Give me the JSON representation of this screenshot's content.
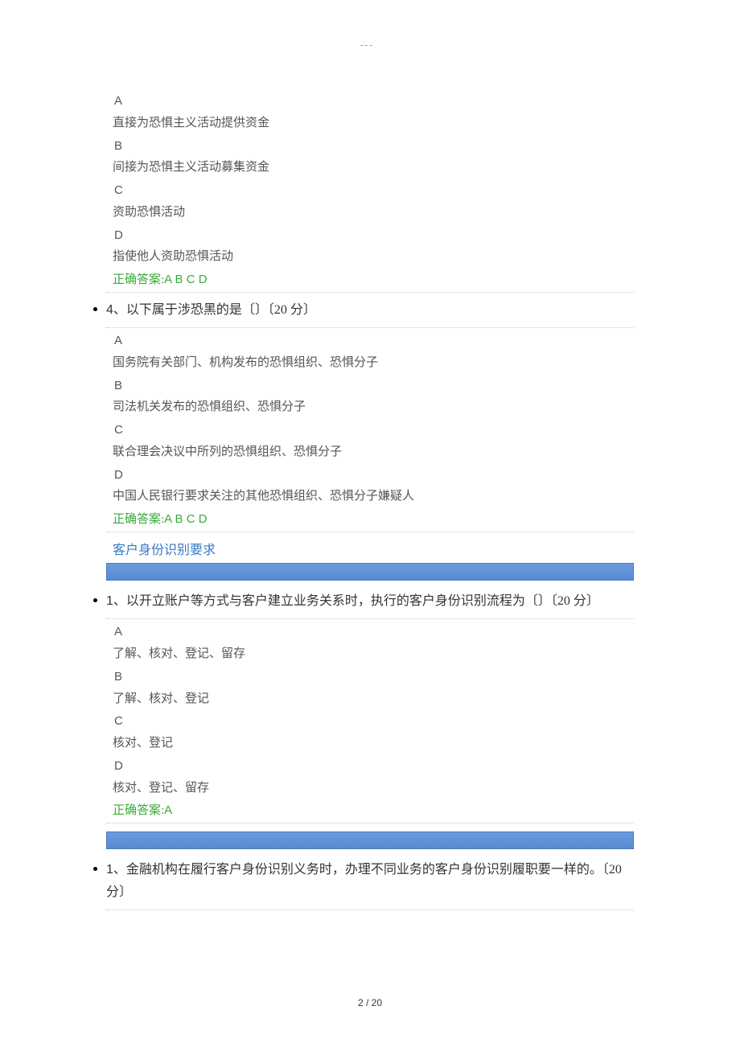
{
  "header_link": "---",
  "q3": {
    "options": [
      {
        "letter": "A",
        "text": "直接为恐惧主义活动提供资金"
      },
      {
        "letter": "B",
        "text": "间接为恐惧主义活动募集资金"
      },
      {
        "letter": "C",
        "text": "资助恐惧活动"
      },
      {
        "letter": "D",
        "text": "指使他人资助恐惧活动"
      }
    ],
    "answer_label": "正确答案:",
    "answer_value": "A B C D"
  },
  "q4": {
    "number": "4、",
    "stem": "以下属于涉恐黑的是〔〕〔20 分〕",
    "options": [
      {
        "letter": "A",
        "text": "国务院有关部门、机构发布的恐惧组织、恐惧分子"
      },
      {
        "letter": "B",
        "text": "司法机关发布的恐惧组织、恐惧分子"
      },
      {
        "letter": "C",
        "text": "联合理会决议中所列的恐惧组织、恐惧分子"
      },
      {
        "letter": "D",
        "text": "中国人民银行要求关注的其他恐惧组织、恐惧分子嫌疑人"
      }
    ],
    "answer_label": "正确答案:",
    "answer_value": "A B C D"
  },
  "section2": {
    "title": "客户身份识别要求"
  },
  "s2q1": {
    "number": "1、",
    "stem": "以开立账户等方式与客户建立业务关系时，执行的客户身份识别流程为〔〕〔20 分〕",
    "options": [
      {
        "letter": "A",
        "text": "了解、核对、登记、留存"
      },
      {
        "letter": "B",
        "text": "了解、核对、登记"
      },
      {
        "letter": "C",
        "text": "核对、登记"
      },
      {
        "letter": "D",
        "text": "核对、登记、留存"
      }
    ],
    "answer_label": "正确答案:",
    "answer_value": "A"
  },
  "s2q2": {
    "number": "1、",
    "stem": "金融机构在履行客户身份识别义务时，办理不同业务的客户身份识别履职要一样的。〔20 分〕"
  },
  "page_number": "2 / 20"
}
